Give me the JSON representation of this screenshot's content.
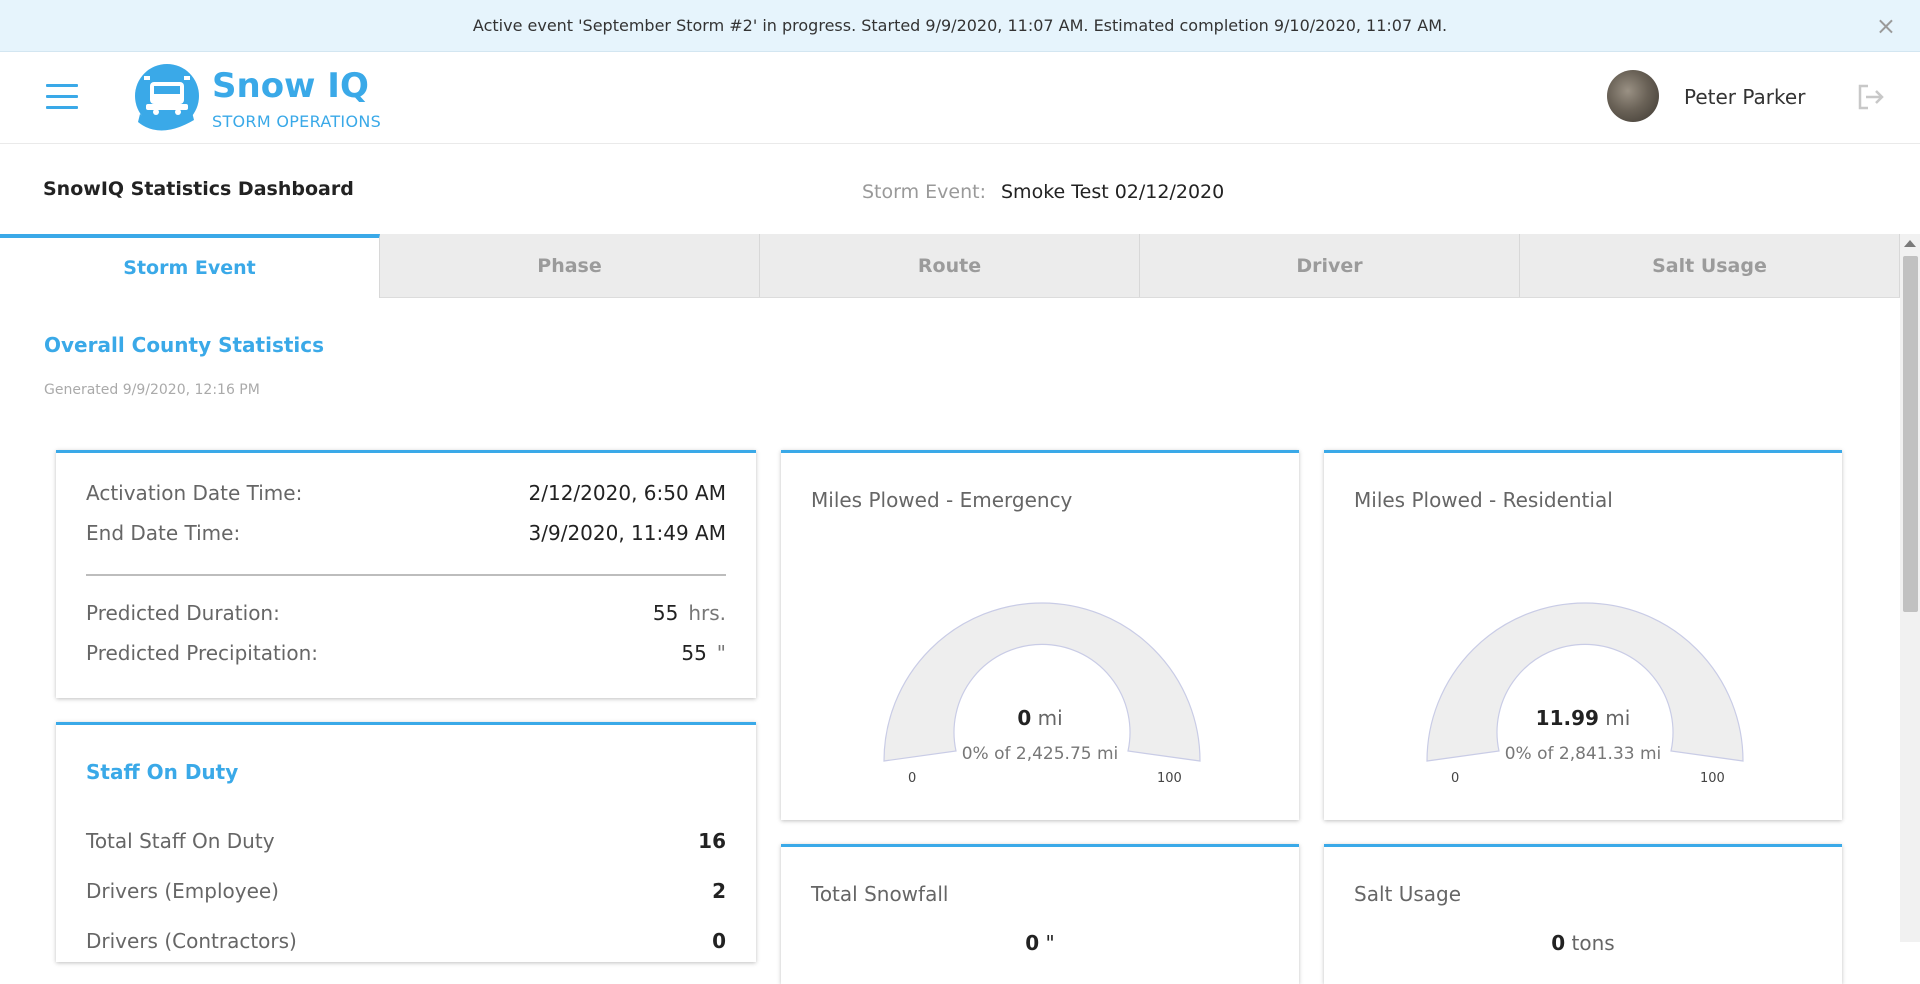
{
  "banner": {
    "text": "Active event 'September Storm #2' in progress. Started 9/9/2020, 11:07 AM. Estimated completion 9/10/2020, 11:07 AM.",
    "close": "×"
  },
  "header": {
    "brand_name": "Snow IQ",
    "brand_sub": "STORM OPERATIONS",
    "user_name": "Peter Parker"
  },
  "titlebar": {
    "title": "SnowIQ Statistics Dashboard",
    "storm_label": "Storm Event:",
    "storm_value": "Smoke Test 02/12/2020"
  },
  "tabs": [
    {
      "label": "Storm Event",
      "active": true
    },
    {
      "label": "Phase"
    },
    {
      "label": "Route"
    },
    {
      "label": "Driver"
    },
    {
      "label": "Salt Usage"
    }
  ],
  "section": {
    "title": "Overall County Statistics",
    "generated": "Generated 9/9/2020, 12:16 PM"
  },
  "event_card": {
    "activation_label": "Activation Date Time:",
    "activation_value": "2/12/2020, 6:50 AM",
    "end_label": "End Date Time:",
    "end_value": "3/9/2020, 11:49 AM",
    "duration_label": "Predicted Duration:",
    "duration_value": "55",
    "duration_unit": "hrs.",
    "precip_label": "Predicted Precipitation:",
    "precip_value": "55",
    "precip_unit": "\""
  },
  "staff_card": {
    "title": "Staff On Duty",
    "rows": [
      {
        "label": "Total Staff On Duty",
        "value": "16"
      },
      {
        "label": "Drivers (Employee)",
        "value": "2"
      },
      {
        "label": "Drivers (Contractors)",
        "value": "0"
      }
    ]
  },
  "gauges": [
    {
      "title": "Miles Plowed - Emergency",
      "value": "0",
      "unit": "mi",
      "subtitle": "0% of 2,425.75 mi",
      "min": "0",
      "max": "100",
      "percent": 0
    },
    {
      "title": "Miles Plowed - Residential",
      "value": "11.99",
      "unit": "mi",
      "subtitle": "0% of 2,841.33 mi",
      "min": "0",
      "max": "100",
      "percent": 0
    }
  ],
  "bottom_cards": [
    {
      "title": "Total Snowfall",
      "value": "0",
      "unit": "\""
    },
    {
      "title": "Salt Usage",
      "value": "0",
      "unit": "tons"
    }
  ],
  "colors": {
    "accent": "#3aa9e8",
    "gauge_fill": "#eeeeee",
    "banner_bg": "#e6f4fc"
  }
}
